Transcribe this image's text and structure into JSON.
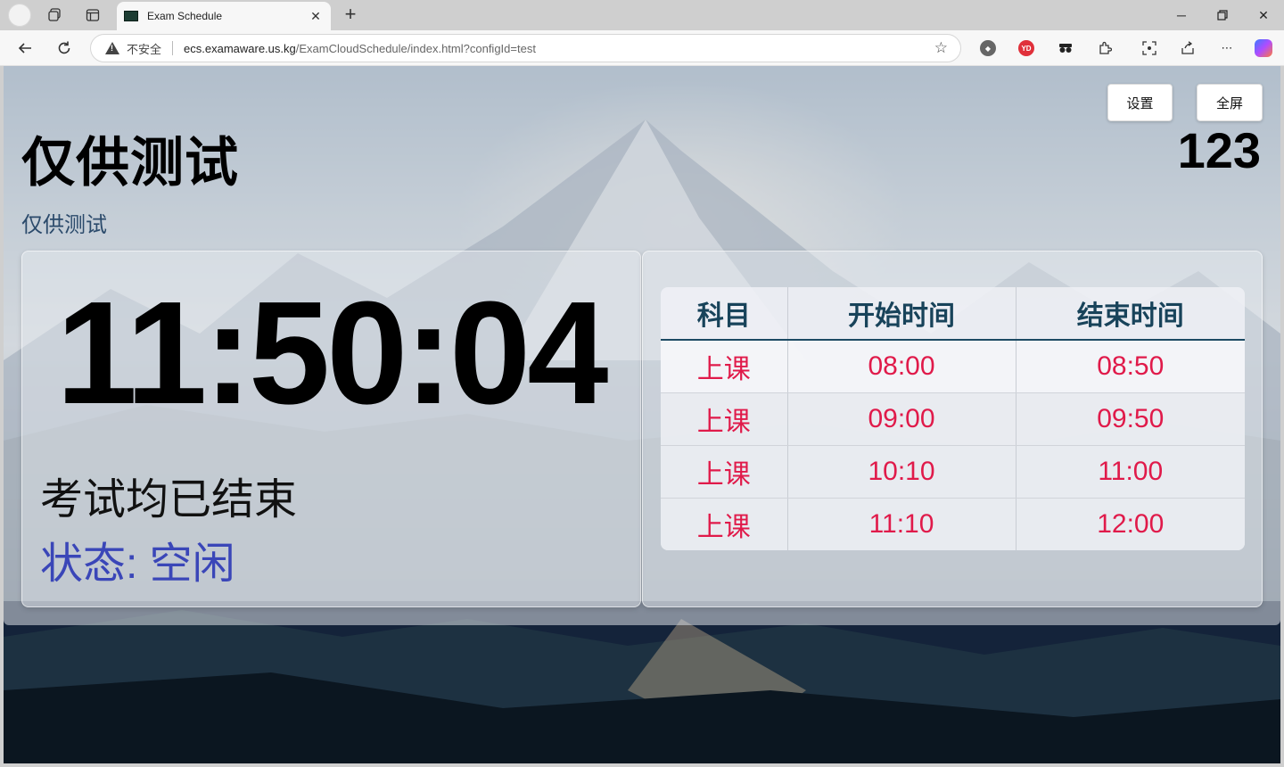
{
  "browser": {
    "tab_title": "Exam Schedule",
    "insecure_label": "不安全",
    "url_host": "ecs.examaware.us.kg",
    "url_path": "/ExamCloudSchedule/index.html?configId=test",
    "ext_labels": [
      "YD"
    ]
  },
  "page": {
    "title": "仅供测试",
    "subtitle": "仅供测试",
    "room": "123",
    "settings_label": "设置",
    "fullscreen_label": "全屏",
    "clock": "11:50:04",
    "message": "考试均已结束",
    "status": "状态: 空闲",
    "schedule": {
      "headers": [
        "科目",
        "开始时间",
        "结束时间"
      ],
      "rows": [
        {
          "subject": "上课",
          "start": "08:00",
          "end": "08:50"
        },
        {
          "subject": "上课",
          "start": "09:00",
          "end": "09:50"
        },
        {
          "subject": "上课",
          "start": "10:10",
          "end": "11:00"
        },
        {
          "subject": "上课",
          "start": "11:10",
          "end": "12:00"
        }
      ]
    }
  }
}
